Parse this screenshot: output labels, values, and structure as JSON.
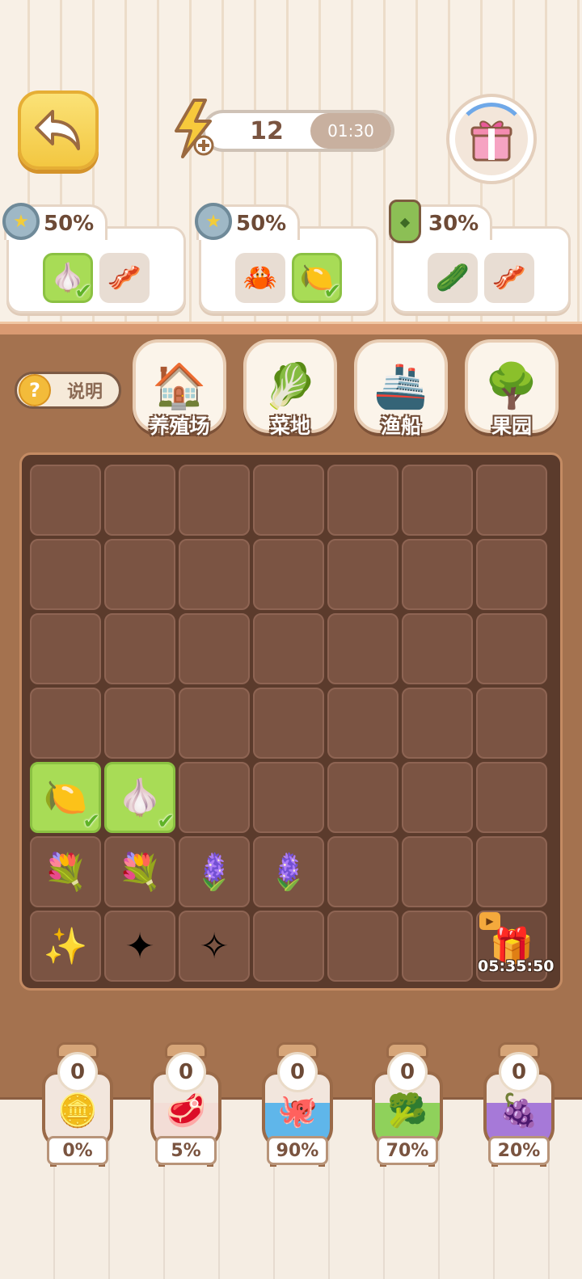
{
  "header": {
    "energy": "12",
    "energy_timer": "01:30"
  },
  "orders": [
    {
      "percent": "50%",
      "badge": "star-coin",
      "items": [
        {
          "icon": "garlic",
          "glyph": "🧄",
          "done": true
        },
        {
          "icon": "bacon",
          "glyph": "🥓",
          "done": false
        }
      ]
    },
    {
      "percent": "50%",
      "badge": "star-coin",
      "items": [
        {
          "icon": "crab",
          "glyph": "🦀",
          "done": false
        },
        {
          "icon": "lemon",
          "glyph": "🍋",
          "done": true
        }
      ]
    },
    {
      "percent": "30%",
      "badge": "pickle-jar",
      "items": [
        {
          "icon": "cucumber",
          "glyph": "🥒",
          "done": false
        },
        {
          "icon": "bacon",
          "glyph": "🥓",
          "done": false
        }
      ]
    }
  ],
  "help_label": "说明",
  "categories": [
    {
      "name": "farm",
      "label": "养殖场",
      "glyph": "🏠"
    },
    {
      "name": "vegetable-field",
      "label": "菜地",
      "glyph": "🥬"
    },
    {
      "name": "fishing-boat",
      "label": "渔船",
      "glyph": "🚢"
    },
    {
      "name": "orchard",
      "label": "果园",
      "glyph": "🌳"
    }
  ],
  "board": {
    "rows": 7,
    "cols": 7,
    "items": [
      {
        "row": 4,
        "col": 0,
        "icon": "lemon",
        "glyph": "🍋",
        "done": true
      },
      {
        "row": 4,
        "col": 1,
        "icon": "garlic",
        "glyph": "🧄",
        "done": true
      },
      {
        "row": 5,
        "col": 0,
        "icon": "lavender-bunch-large",
        "glyph": "💐"
      },
      {
        "row": 5,
        "col": 1,
        "icon": "lavender-bunch-medium",
        "glyph": "💐"
      },
      {
        "row": 5,
        "col": 2,
        "icon": "lavender-pair",
        "glyph": "🪻"
      },
      {
        "row": 5,
        "col": 3,
        "icon": "lavender-single",
        "glyph": "🪻"
      },
      {
        "row": 6,
        "col": 0,
        "icon": "sparkle-crystal-large",
        "glyph": "✨"
      },
      {
        "row": 6,
        "col": 1,
        "icon": "sparkle-crystal-medium",
        "glyph": "✦"
      },
      {
        "row": 6,
        "col": 2,
        "icon": "sparkle-crystal-small",
        "glyph": "✧"
      },
      {
        "row": 6,
        "col": 6,
        "icon": "gift-box",
        "glyph": "🎁",
        "timer": "05:35:50"
      }
    ]
  },
  "baskets": [
    {
      "count": "0",
      "percent": "0%",
      "icon": "star-coin",
      "glyph": "🪙",
      "color": "#f2e6dd"
    },
    {
      "count": "0",
      "percent": "5%",
      "icon": "meat",
      "glyph": "🥩",
      "color": "#f3ddd6"
    },
    {
      "count": "0",
      "percent": "90%",
      "icon": "octopus",
      "glyph": "🐙",
      "color": "#5fb6ea"
    },
    {
      "count": "0",
      "percent": "70%",
      "icon": "broccoli",
      "glyph": "🥦",
      "color": "#8fd15b"
    },
    {
      "count": "0",
      "percent": "20%",
      "icon": "grapes",
      "glyph": "🍇",
      "color": "#a679d8"
    }
  ]
}
